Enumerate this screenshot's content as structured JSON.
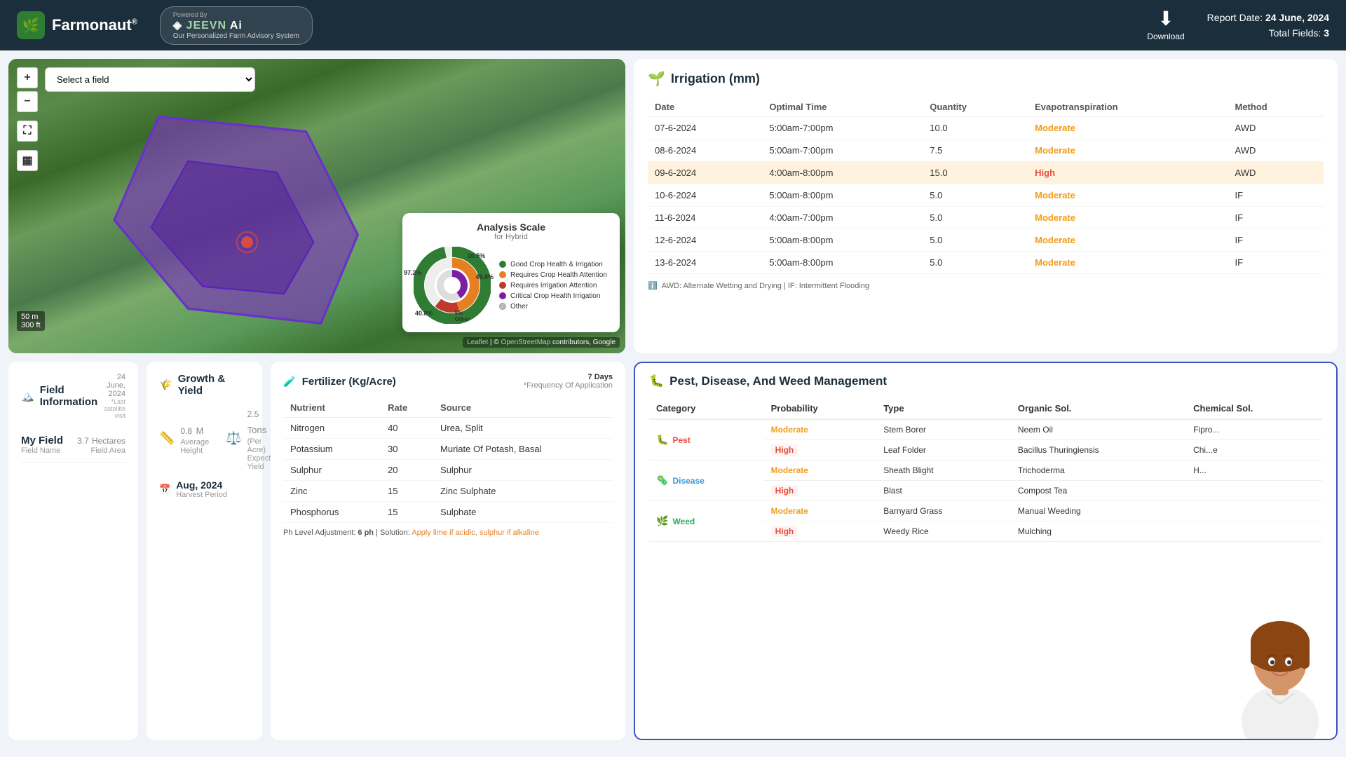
{
  "header": {
    "logo_text": "Farmonaut",
    "logo_sup": "®",
    "logo_icon": "🌿",
    "jeevn_name": "JEEVN Ai",
    "powered_by": "Powered By",
    "advisory": "Our Personalized Farm Advisory System",
    "download_label": "Download",
    "report_date_label": "Report Date:",
    "report_date": "24 June, 2024",
    "total_fields_label": "Total Fields:",
    "total_fields": "3"
  },
  "map": {
    "field_select_placeholder": "Select a field",
    "zoom_in": "+",
    "zoom_out": "−",
    "scale_50m": "50 m",
    "scale_300ft": "300 ft",
    "attribution": "Leaflet | © OpenStreetMap contributors, Google"
  },
  "analysis_scale": {
    "title": "Analysis Scale",
    "subtitle": "for Hybrid",
    "pct_972": "97.2%",
    "pct_105": "10.5%",
    "pct_458": "45.8%",
    "pct_408": "40.8%",
    "pct_5": "5%",
    "pct_other": "Other",
    "legend": [
      {
        "label": "Good Crop Health & Irrigation",
        "color": "#2e7d32"
      },
      {
        "label": "Requires Crop Health Attention",
        "color": "#e67e22"
      },
      {
        "label": "Requires Irrigation Attention",
        "color": "#c0392b"
      },
      {
        "label": "Critical Crop Health Irrigation",
        "color": "#7b1fa2"
      },
      {
        "label": "Other",
        "color": "#bbb"
      }
    ]
  },
  "irrigation": {
    "title": "Irrigation (mm)",
    "icon": "🌱",
    "columns": [
      "Date",
      "Optimal Time",
      "Quantity",
      "Evapotranspiration",
      "Method"
    ],
    "rows": [
      {
        "date": "07-6-2024",
        "time": "5:00am-7:00pm",
        "qty": "10.0",
        "evap": "Moderate",
        "method": "AWD",
        "highlight": false
      },
      {
        "date": "08-6-2024",
        "time": "5:00am-7:00pm",
        "qty": "7.5",
        "evap": "Moderate",
        "method": "AWD",
        "highlight": false
      },
      {
        "date": "09-6-2024",
        "time": "4:00am-8:00pm",
        "qty": "15.0",
        "evap": "High",
        "method": "AWD",
        "highlight": true
      },
      {
        "date": "10-6-2024",
        "time": "5:00am-8:00pm",
        "qty": "5.0",
        "evap": "Moderate",
        "method": "IF",
        "highlight": false
      },
      {
        "date": "11-6-2024",
        "time": "4:00am-7:00pm",
        "qty": "5.0",
        "evap": "Moderate",
        "method": "IF",
        "highlight": false
      },
      {
        "date": "12-6-2024",
        "time": "5:00am-8:00pm",
        "qty": "5.0",
        "evap": "Moderate",
        "method": "IF",
        "highlight": false
      },
      {
        "date": "13-6-2024",
        "time": "5:00am-8:00pm",
        "qty": "5.0",
        "evap": "Moderate",
        "method": "IF",
        "highlight": false
      }
    ],
    "note": "AWD: Alternate Wetting and Drying | IF: Intermittent Flooding"
  },
  "field_info": {
    "title": "Field Information",
    "icon": "🏔️",
    "date": "24 June, 2024",
    "last_satellite": "*Last satellite visit",
    "field_name_label": "My Field",
    "field_name_sub": "Field Name",
    "area": "3.7",
    "area_unit": "Hectares",
    "area_label": "Field Area"
  },
  "growth": {
    "title": "Growth & Yield",
    "icon": "🌾",
    "height": "0.8",
    "height_unit": "M",
    "height_label": "Average Height",
    "yield": "2.5",
    "yield_unit": "Tons",
    "yield_per": "(Per Acre)",
    "yield_label": "Expected Yield",
    "harvest": "Aug, 2024",
    "harvest_label": "Harvest Period"
  },
  "fertilizer": {
    "title": "Fertilizer (Kg/Acre)",
    "icon": "🧪",
    "freq": "7 Days",
    "freq_label": "*Frequency Of Application",
    "columns": [
      "Nutrient",
      "Rate",
      "Source"
    ],
    "rows": [
      {
        "nutrient": "Nitrogen",
        "rate": "40",
        "source": "Urea, Split"
      },
      {
        "nutrient": "Potassium",
        "rate": "30",
        "source": "Muriate Of Potash, Basal"
      },
      {
        "nutrient": "Sulphur",
        "rate": "20",
        "source": "Sulphur"
      },
      {
        "nutrient": "Zinc",
        "rate": "15",
        "source": "Zinc Sulphate"
      },
      {
        "nutrient": "Phosphorus",
        "rate": "15",
        "source": "Sulphate"
      }
    ],
    "ph_label": "Ph Level Adjustment:",
    "ph_val": "6 ph",
    "solution_label": "Solution:",
    "solution_text": "Apply lime if acidic, sulphur if alkaline"
  },
  "pest": {
    "title": "Pest, Disease, And Weed Management",
    "icon": "🐛",
    "columns": [
      "Category",
      "Probability",
      "Type",
      "Organic Sol.",
      "Chemical Sol."
    ],
    "categories": [
      {
        "name": "Pest",
        "icon": "🐛",
        "color": "#e74c3c",
        "items": [
          {
            "prob": "Moderate",
            "type": "Stem Borer",
            "organic": "Neem Oil",
            "chemical": "Fipro..."
          },
          {
            "prob": "High",
            "type": "Leaf Folder",
            "organic": "Bacillus Thuringiensis",
            "chemical": "Chi...e"
          }
        ]
      },
      {
        "name": "Disease",
        "icon": "🦠",
        "color": "#3498db",
        "items": [
          {
            "prob": "Moderate",
            "type": "Sheath Blight",
            "organic": "Trichoderma",
            "chemical": "H..."
          },
          {
            "prob": "High",
            "type": "Blast",
            "organic": "Compost Tea",
            "chemical": ""
          }
        ]
      },
      {
        "name": "Weed",
        "icon": "🌿",
        "color": "#27ae60",
        "items": [
          {
            "prob": "Moderate",
            "type": "Barnyard Grass",
            "organic": "Manual Weeding",
            "chemical": ""
          },
          {
            "prob": "High",
            "type": "Weedy Rice",
            "organic": "Mulching",
            "chemical": ""
          }
        ]
      }
    ]
  }
}
